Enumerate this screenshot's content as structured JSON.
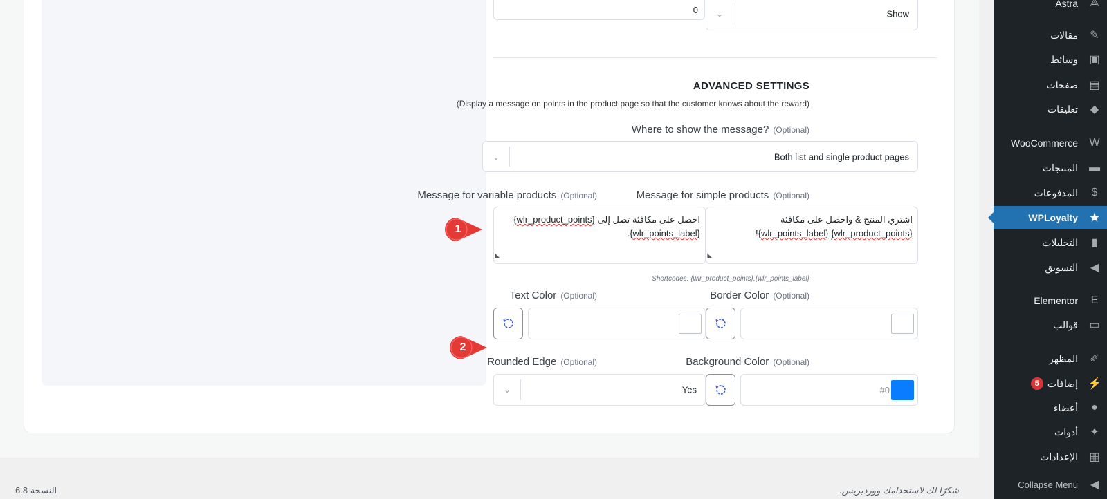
{
  "sidebar": {
    "items": [
      {
        "label": "Astra",
        "icon": "astra-icon",
        "glyph": "⟁"
      },
      {
        "label": "مقالات",
        "icon": "pin-icon",
        "glyph": "✎"
      },
      {
        "label": "وسائط",
        "icon": "media-icon",
        "glyph": "▣"
      },
      {
        "label": "صفحات",
        "icon": "page-icon",
        "glyph": "▤"
      },
      {
        "label": "تعليقات",
        "icon": "comment-icon",
        "glyph": "◆"
      },
      {
        "label": "WooCommerce",
        "icon": "woocommerce-icon",
        "glyph": "W"
      },
      {
        "label": "المنتجات",
        "icon": "archive-icon",
        "glyph": "▬"
      },
      {
        "label": "المدفوعات",
        "icon": "payments-icon",
        "glyph": "$"
      },
      {
        "label": "WPLoyalty",
        "icon": "wployalty-icon",
        "glyph": "★"
      },
      {
        "label": "التحليلات",
        "icon": "analytics-icon",
        "glyph": "▮"
      },
      {
        "label": "التسويق",
        "icon": "megaphone-icon",
        "glyph": "◀"
      },
      {
        "label": "Elementor",
        "icon": "elementor-icon",
        "glyph": "E"
      },
      {
        "label": "قوالب",
        "icon": "folder-icon",
        "glyph": "▭"
      },
      {
        "label": "المظهر",
        "icon": "brush-icon",
        "glyph": "✐"
      },
      {
        "label": "إضافات",
        "icon": "plugin-icon",
        "glyph": "⚡",
        "badge": "5"
      },
      {
        "label": "أعضاء",
        "icon": "user-icon",
        "glyph": "●"
      },
      {
        "label": "أدوات",
        "icon": "wrench-icon",
        "glyph": "✦"
      },
      {
        "label": "الإعدادات",
        "icon": "settings-icon",
        "glyph": "▦"
      }
    ],
    "collapse_label": "Collapse Menu"
  },
  "top": {
    "number_value": "0",
    "show_select": "Show"
  },
  "advanced": {
    "heading": "ADVANCED SETTINGS",
    "description": "(Display a message on points in the product page so that the customer knows about the reward)",
    "where_label": "Where to show the message?",
    "where_value": "Both list and single product pages",
    "optional": "(Optional)",
    "simple_label": "Message for simple products",
    "simple_line1": "اشتري المنتج & واحصل على مكافئة",
    "simple_line2_a": "{wlr_product_points}",
    "simple_line2_b": "{wlr_points_label}",
    "simple_line2_end": "!",
    "variable_label": "Message for variable products",
    "variable_line1_a": "احصل على مكافئة تصل إلى",
    "variable_line1_b": "{wlr_product_points}",
    "variable_line2_a": "{wlr_points_label}",
    "variable_line2_end": ".",
    "shortcodes": "Shortcodes: {wlr_product_points},{wlr_points_label}",
    "border_color_label": "Border Color",
    "text_color_label": "Text Color",
    "background_color_label": "Background Color",
    "background_hex": "#0",
    "background_color": "#0a7cff",
    "rounded_edge_label": "Rounded Edge",
    "rounded_edge_value": "Yes"
  },
  "markers": [
    "1",
    "2"
  ],
  "footer": {
    "thanks": "شكرًا لك لاستخدامك ووردبريس.",
    "version": "النسخة 6.8"
  }
}
